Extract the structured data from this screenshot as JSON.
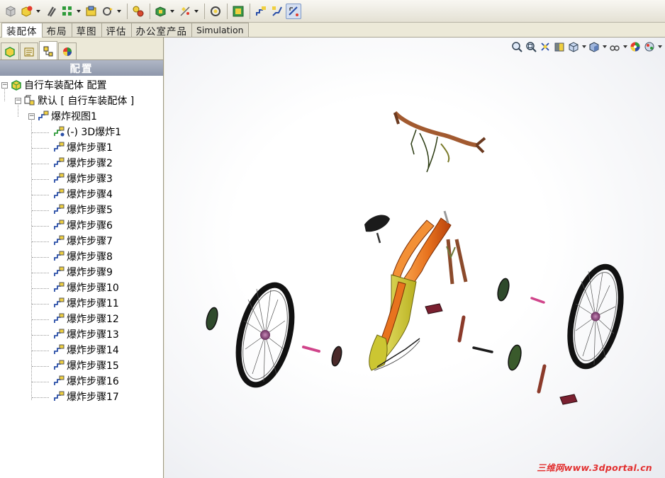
{
  "tabs": [
    {
      "label": "装配体"
    },
    {
      "label": "布局"
    },
    {
      "label": "草图"
    },
    {
      "label": "评估"
    },
    {
      "label": "办公室产品"
    },
    {
      "label": "Simulation"
    }
  ],
  "panel": {
    "header": "配置"
  },
  "tree": {
    "root": "自行车装配体 配置",
    "config": "默认 [ 自行车装配体 ]",
    "explode_view": "爆炸视图1",
    "explode_3d": "(-) 3D爆炸1",
    "steps": [
      "爆炸步骤1",
      "爆炸步骤2",
      "爆炸步骤3",
      "爆炸步骤4",
      "爆炸步骤5",
      "爆炸步骤6",
      "爆炸步骤7",
      "爆炸步骤8",
      "爆炸步骤9",
      "爆炸步骤10",
      "爆炸步骤11",
      "爆炸步骤12",
      "爆炸步骤13",
      "爆炸步骤14",
      "爆炸步骤15",
      "爆炸步骤16",
      "爆炸步骤17"
    ]
  },
  "watermark": "三维网www.3dportal.cn",
  "colors": {
    "frame_orange": "#e8731e",
    "frame_yellow": "#d9d23a",
    "rim_black": "#111111",
    "hub_purple": "#7a3b6e",
    "watermark_red": "#e23030"
  }
}
